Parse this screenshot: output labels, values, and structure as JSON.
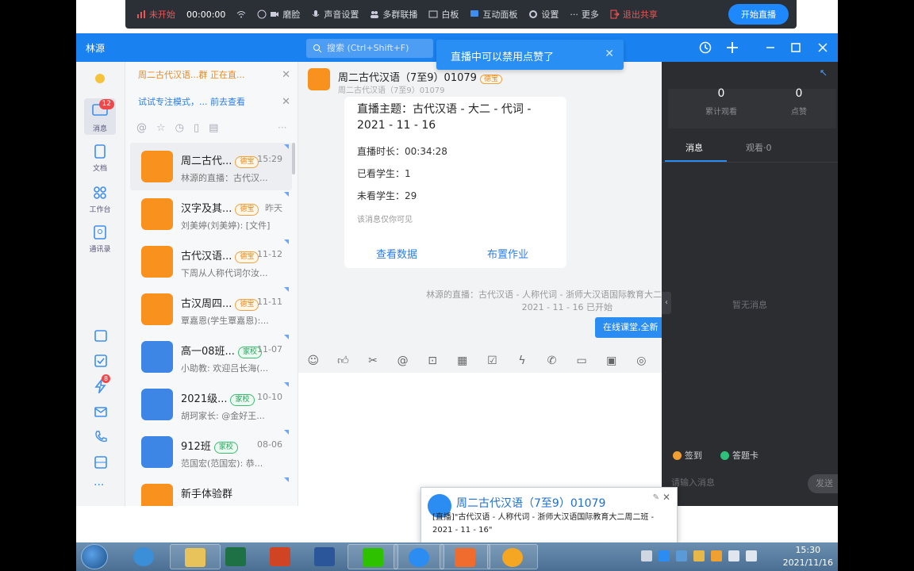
{
  "live_toolbar": {
    "status": "未开始",
    "timer": "00:00:00",
    "beauty": "磨脸",
    "audio": "声音设置",
    "multi": "多群联播",
    "whiteboard": "白板",
    "interact": "互动面板",
    "settings": "设置",
    "more": "更多",
    "exit_share": "退出共享",
    "start_live": "开始直播"
  },
  "window": {
    "title": "林源",
    "search_placeholder": "搜索 (Ctrl+Shift+F)",
    "toast": "直播中可以禁用点赞了"
  },
  "nav": {
    "messages_label": "消息",
    "messages_badge": "12",
    "docs_label": "文档",
    "workbench_label": "工作台",
    "contacts_label": "通讯录",
    "ding_badge": "8"
  },
  "notices": [
    {
      "text": "周二古代汉语...群  正在直...",
      "color": "#e98a1c"
    },
    {
      "text": "试试专注模式，...   前去查看",
      "color": "#2b7de9"
    }
  ],
  "conversations": [
    {
      "title": "周二古代...",
      "tag": "德宝",
      "time": "15:29",
      "sub": "林源的直播：古代汉...",
      "type": "orange"
    },
    {
      "title": "汉字及其...",
      "tag": "德宝",
      "time": "昨天",
      "sub": "刘美婷(刘美婷): [文件]",
      "type": "orange"
    },
    {
      "title": "古代汉语...",
      "tag": "德宝",
      "time": "11-12",
      "sub": "下周从人称代词尔汝...",
      "type": "orange"
    },
    {
      "title": "古汉周四...",
      "tag": "德宝",
      "time": "11-11",
      "sub": "覃嘉恩(学生覃嘉恩):...",
      "type": "orange"
    },
    {
      "title": "高一08班...",
      "tag": "家校",
      "time": "11-07",
      "sub": "小助教: 欢迎吕长海(...",
      "type": "grid"
    },
    {
      "title": "2021级...",
      "tag": "家校",
      "time": "10-10",
      "sub": "胡珂家长: @金好王...",
      "type": "grid"
    },
    {
      "title": "912班",
      "tag": "家校",
      "time": "08-06",
      "sub": "范国宏(范国宏): 恭...",
      "type": "grid"
    },
    {
      "title": "新手体验群",
      "tag": "",
      "time": "",
      "sub": "",
      "type": "orange"
    }
  ],
  "chat": {
    "title": "周二古代汉语（7至9）01079",
    "title_tag": "德宝",
    "subtitle": "周二古代汉语（7至9）01079",
    "card": {
      "topic": "直播主题：古代汉语 - 大二 - 代词 - 2021 - 11 - 16",
      "duration": "直播时长：00:34:28",
      "watched": "已看学生：1",
      "unwatched": "未看学生：29",
      "visibility": "该消息仅你可见",
      "view_data": "查看数据",
      "assign_homework": "布置作业"
    },
    "system_msg_1": "林源的直播：古代汉语 - 人称代词 - 浙师大汉语国际教育大二",
    "system_msg_2": "2021 - 11 - 16 已开始",
    "floating_tip": "在线课堂,全新"
  },
  "live_panel": {
    "viewers_value": "0",
    "viewers_label": "累计观看",
    "likes_value": "0",
    "likes_label": "点赞",
    "tab_messages": "消息",
    "tab_watching": "观看·0",
    "empty": "暂无消息",
    "checkin": "签到",
    "answer_card": "答题卡",
    "input_placeholder": "请输入消息",
    "send": "发送"
  },
  "popup": {
    "title": "周二古代汉语（7至9）01079",
    "body": "[直播]\"古代汉语 - 人称代词 - 浙师大汉语国际教育大二周二班 - 2021 - 11 - 16\""
  },
  "taskbar": {
    "time": "15:30",
    "date": "2021/11/16"
  },
  "colors": {
    "brand_blue": "#1a82f0",
    "orange": "#f8911e",
    "dark_panel": "#2c2d31"
  }
}
